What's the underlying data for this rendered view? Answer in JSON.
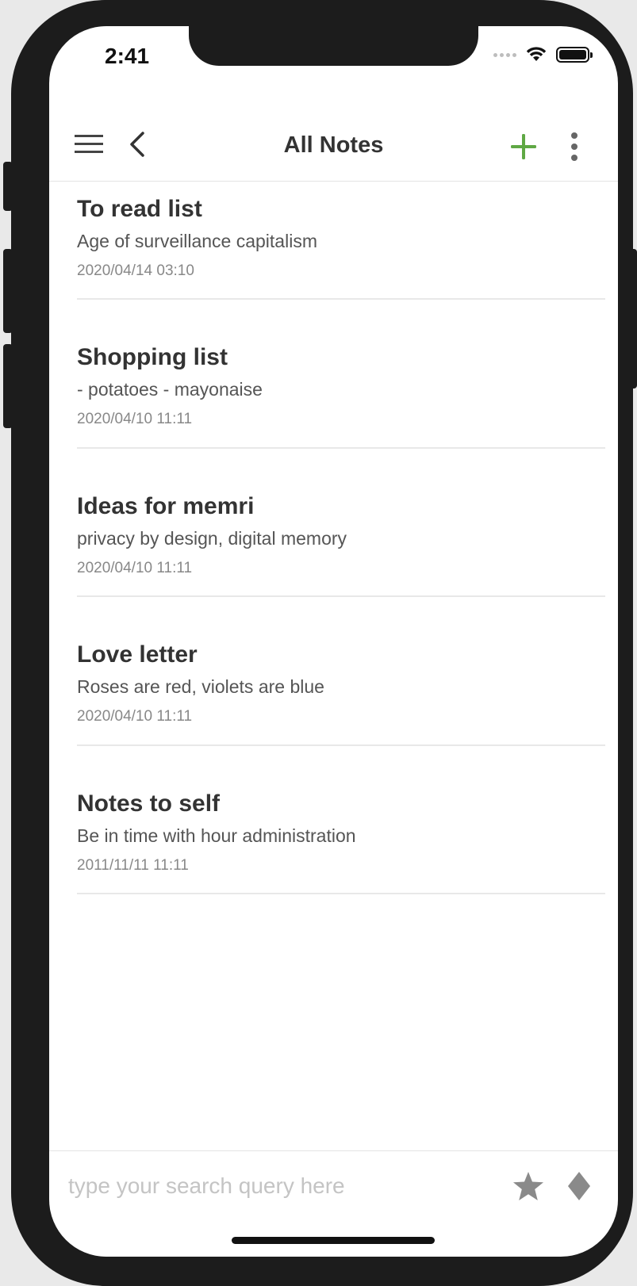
{
  "status_bar": {
    "time": "2:41"
  },
  "nav": {
    "title": "All Notes",
    "menu_icon": "hamburger-menu-icon",
    "back_icon": "chevron-left-icon",
    "add_icon": "plus-icon",
    "more_icon": "vertical-ellipsis-icon",
    "accent_color": "#5fa844"
  },
  "notes": [
    {
      "title": "To read list",
      "body": "Age of surveillance capitalism",
      "date": "2020/04/14 03:10"
    },
    {
      "title": "Shopping list",
      "body": "- potatoes - mayonaise",
      "date": "2020/04/10 11:11"
    },
    {
      "title": "Ideas for memri",
      "body": "privacy by design, digital memory",
      "date": "2020/04/10 11:11"
    },
    {
      "title": "Love letter",
      "body": "Roses are red, violets are blue",
      "date": "2020/04/10 11:11"
    },
    {
      "title": "Notes to self",
      "body": "Be in time with hour administration",
      "date": "2011/11/11 11:11"
    }
  ],
  "search": {
    "placeholder": "type your search query here",
    "value": ""
  },
  "bottom_bar": {
    "star_icon": "star-icon",
    "diamond_icon": "diamond-icon"
  }
}
